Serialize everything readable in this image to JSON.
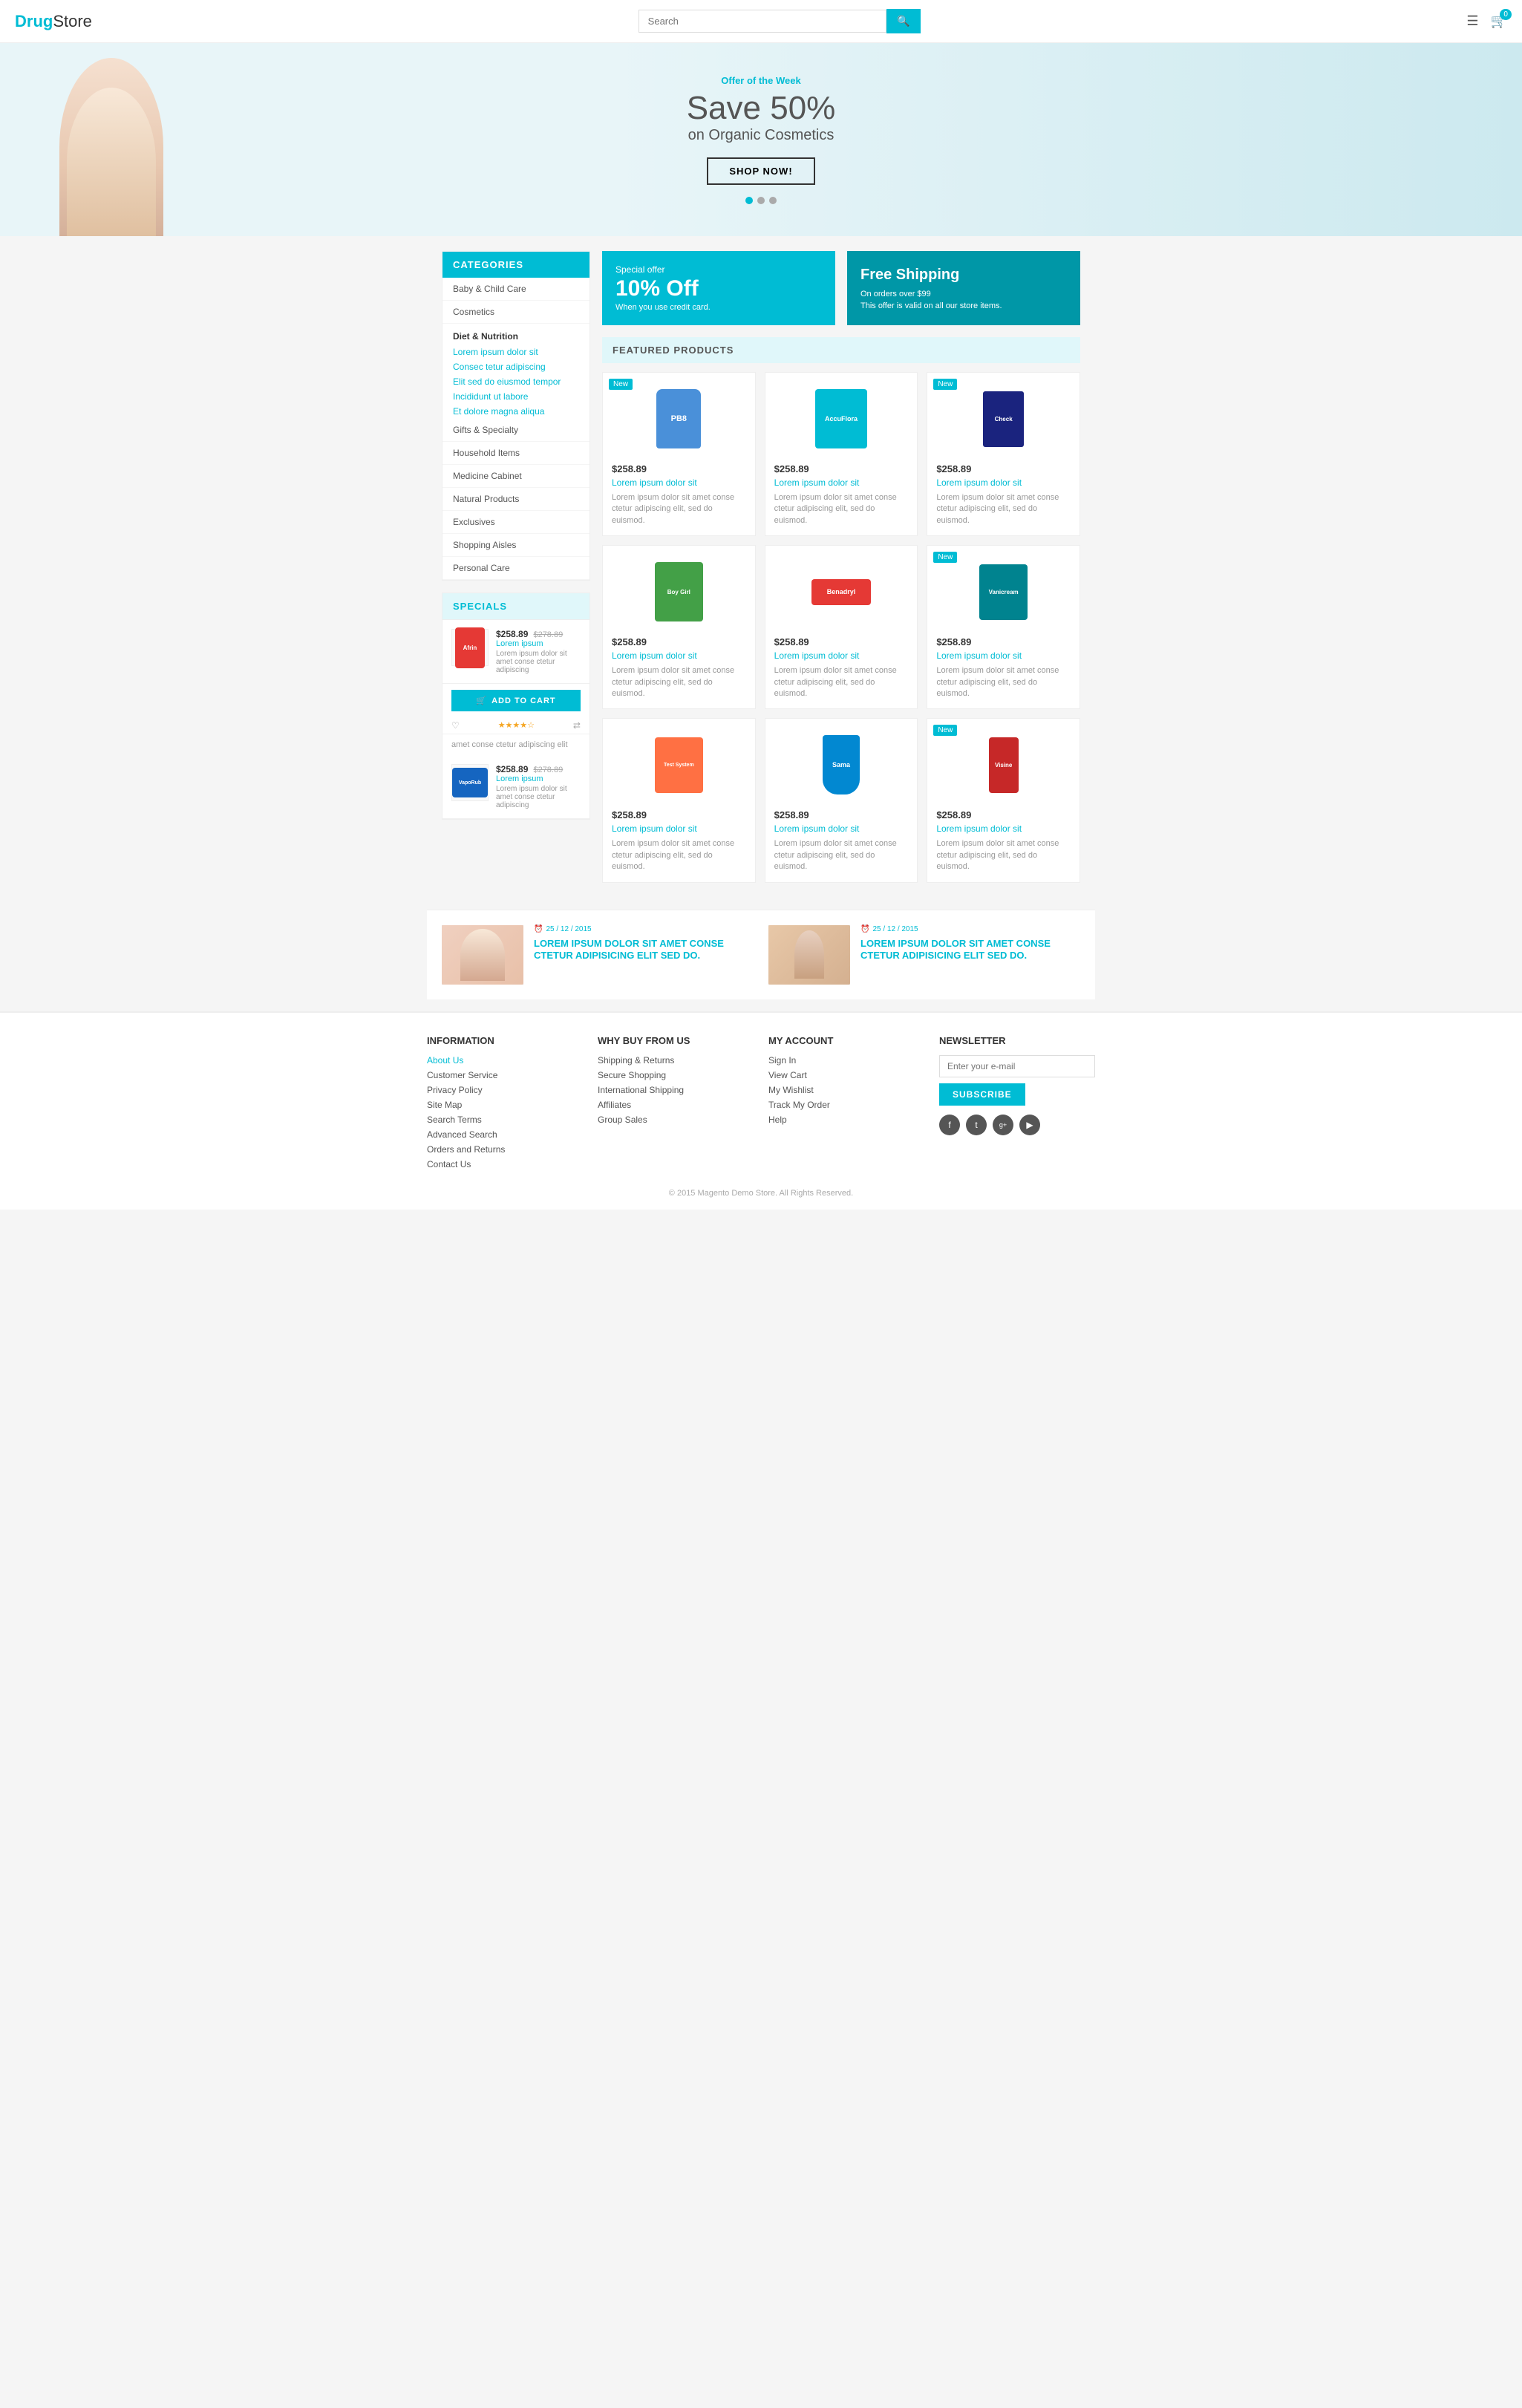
{
  "header": {
    "logo_drug": "Drug",
    "logo_store": "Store",
    "search_placeholder": "Search",
    "search_btn_icon": "🔍",
    "menu_icon": "☰",
    "cart_icon": "🛒",
    "cart_count": "0"
  },
  "hero": {
    "offer_label": "Offer of the Week",
    "title_line1": "Save 50%",
    "title_line2": "on Organic Cosmetics",
    "btn_label": "SHOP NOW!",
    "dots": [
      "active",
      "",
      ""
    ]
  },
  "promo_boxes": [
    {
      "label": "Special offer",
      "main": "10% Off",
      "sub": "When you use credit card."
    },
    {
      "label": "Free Shipping",
      "main": "",
      "sub": "On orders over $99",
      "sub2": "This offer is valid on all our store items."
    }
  ],
  "sidebar": {
    "categories_title": "CATEGORIES",
    "categories": [
      "Baby & Child Care",
      "Cosmetics"
    ],
    "diet_section": "Diet & Nutrition",
    "diet_links": [
      "Lorem ipsum dolor sit",
      "Consec tetur adipiscing",
      "Elit sed do eiusmod tempor",
      "Incididunt ut labore",
      "Et dolore magna aliqua"
    ],
    "other_categories": [
      "Gifts & Specialty",
      "Household Items",
      "Medicine Cabinet",
      "Natural Products",
      "Exclusives",
      "Shopping Aisles",
      "Personal Care"
    ],
    "specials_title": "SPECIALS",
    "special_items": [
      {
        "name": "Afrin",
        "name_link": "Lorem ipsum",
        "price_new": "$258.89",
        "price_old": "$278.89",
        "desc": "Lorem ipsum dolor sit amet conse ctetur adipiscing",
        "btn_label": "ADD TO CART",
        "rating": "★★★★☆",
        "desc2": "amet conse ctetur adipiscing elit"
      },
      {
        "name": "VapoRub",
        "name_link": "Lorem ipsum",
        "price_new": "$258.89",
        "price_old": "$278.89",
        "desc": "Lorem ipsum dolor sit amet conse ctetur adipiscing",
        "rating": ""
      }
    ]
  },
  "featured": {
    "title": "FEATURED PRODUCTS",
    "products": [
      {
        "badge": "New",
        "price": "$258.89",
        "name": "Lorem ipsum dolor sit",
        "desc": "Lorem ipsum dolor sit amet conse ctetur adipiscing elit, sed do euismod.",
        "color": "#4a90d9",
        "label": "PB8"
      },
      {
        "badge": "",
        "price": "$258.89",
        "name": "Lorem ipsum dolor sit",
        "desc": "Lorem ipsum dolor sit amet conse ctetur adipiscing elit, sed do euismod.",
        "color": "#00bcd4",
        "label": "AccuFlora"
      },
      {
        "badge": "New",
        "price": "$258.89",
        "name": "Lorem ipsum dolor sit",
        "desc": "Lorem ipsum dolor sit amet conse ctetur adipiscing elit, sed do euismod.",
        "color": "#1a237e",
        "label": "Check"
      },
      {
        "badge": "",
        "price": "$258.89",
        "name": "Lorem ipsum dolor sit",
        "desc": "Lorem ipsum dolor sit amet conse ctetur adipiscing elit, sed do euismod.",
        "color": "#43a047",
        "label": "Boy Girl"
      },
      {
        "badge": "",
        "price": "$258.89",
        "name": "Lorem ipsum dolor sit",
        "desc": "Lorem ipsum dolor sit amet conse ctetur adipiscing elit, sed do euismod.",
        "color": "#e53935",
        "label": "Benadryl"
      },
      {
        "badge": "New",
        "price": "$258.89",
        "name": "Lorem ipsum dolor sit",
        "desc": "Lorem ipsum dolor sit amet conse ctetur adipiscing elit, sed do euismod.",
        "color": "#00838f",
        "label": "Vanicream"
      },
      {
        "badge": "",
        "price": "$258.89",
        "name": "Lorem ipsum dolor sit",
        "desc": "Lorem ipsum dolor sit amet conse ctetur adipiscing elit, sed do euismod.",
        "color": "#ff7043",
        "label": "Test System"
      },
      {
        "badge": "",
        "price": "$258.89",
        "name": "Lorem ipsum dolor sit",
        "desc": "Lorem ipsum dolor sit amet conse ctetur adipiscing elit, sed do euismod.",
        "color": "#0288d1",
        "label": "Sama"
      },
      {
        "badge": "New",
        "price": "$258.89",
        "name": "Lorem ipsum dolor sit",
        "desc": "Lorem ipsum dolor sit amet conse ctetur adipiscing elit, sed do euismod.",
        "color": "#c62828",
        "label": "Visine"
      }
    ]
  },
  "blog": {
    "items": [
      {
        "date": "25 / 12 / 2015",
        "title": "LOREM IPSUM DOLOR SIT AMET CONSE CTETUR ADIPISICING ELIT SED DO."
      },
      {
        "date": "25 / 12 / 2015",
        "title": "LOREM IPSUM DOLOR SIT AMET CONSE CTETUR ADIPISICING ELIT SED DO."
      }
    ]
  },
  "footer": {
    "information_title": "INFORMATION",
    "information_links": [
      "About Us",
      "Customer Service",
      "Privacy Policy",
      "Site Map",
      "Search Terms",
      "Advanced Search",
      "Orders and Returns",
      "Contact Us"
    ],
    "why_buy_title": "WHY BUY FROM US",
    "why_buy_links": [
      "Shipping & Returns",
      "Secure Shopping",
      "International Shipping",
      "Affiliates",
      "Group Sales"
    ],
    "my_account_title": "MY ACCOUNT",
    "my_account_links": [
      "Sign In",
      "View Cart",
      "My Wishlist",
      "Track My Order",
      "Help"
    ],
    "newsletter_title": "NEWSLETTER",
    "newsletter_placeholder": "Enter your e-mail",
    "subscribe_btn": "SUBSCRIBE",
    "social_icons": [
      "f",
      "t",
      "g+",
      "▶"
    ],
    "copyright": "© 2015 Magento Demo Store. All Rights Reserved."
  }
}
